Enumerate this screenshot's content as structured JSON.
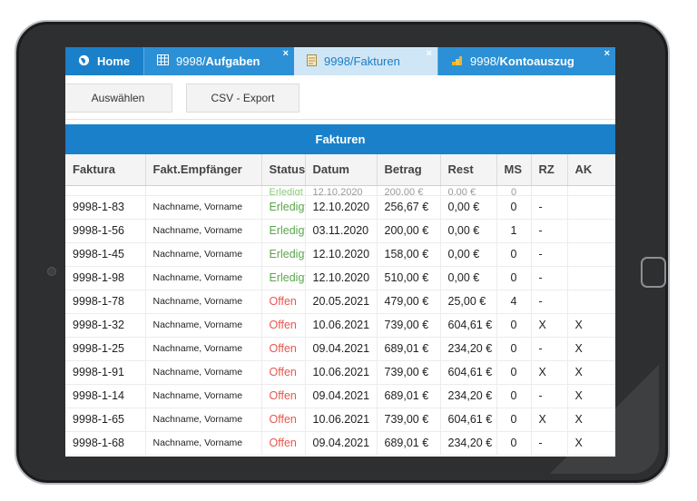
{
  "tabs": [
    {
      "icon": "globe-icon",
      "prefix": "",
      "label": "Home",
      "closable": false
    },
    {
      "icon": "grid-icon",
      "prefix": "9998/",
      "label": "Aufgaben",
      "closable": true
    },
    {
      "icon": "document-icon",
      "prefix": "",
      "label": "9998/Fakturen",
      "closable": true,
      "active": true
    },
    {
      "icon": "coins-icon",
      "prefix": "9998/",
      "label": "Kontoauszug",
      "closable": true
    }
  ],
  "close_glyph": "×",
  "toolbar": {
    "select_label": "Auswählen",
    "csv_label": "CSV - Export"
  },
  "section_title": "Fakturen",
  "columns": [
    "Faktura",
    "Fakt.Empfänger",
    "Status",
    "Datum",
    "Betrag",
    "Rest",
    "MS",
    "RZ",
    "AK"
  ],
  "partial_row": {
    "status": "Erledigt",
    "datum": "12.10.2020",
    "betrag": "200,00 €",
    "rest": "0,00 €",
    "ms": "0"
  },
  "rows": [
    {
      "faktura": "9998-1-83",
      "empf": "Nachname, Vorname",
      "status": "Erledigt",
      "datum": "12.10.2020",
      "betrag": "256,67 €",
      "rest": "0,00 €",
      "ms": "0",
      "rz": "-",
      "ak": ""
    },
    {
      "faktura": "9998-1-56",
      "empf": "Nachname, Vorname",
      "status": "Erledigt",
      "datum": "03.11.2020",
      "betrag": "200,00 €",
      "rest": "0,00 €",
      "ms": "1",
      "rz": "-",
      "ak": ""
    },
    {
      "faktura": "9998-1-45",
      "empf": "Nachname, Vorname",
      "status": "Erledigt",
      "datum": "12.10.2020",
      "betrag": "158,00 €",
      "rest": "0,00 €",
      "ms": "0",
      "rz": "-",
      "ak": ""
    },
    {
      "faktura": "9998-1-98",
      "empf": "Nachname, Vorname",
      "status": "Erledigt",
      "datum": "12.10.2020",
      "betrag": "510,00 €",
      "rest": "0,00 €",
      "ms": "0",
      "rz": "-",
      "ak": ""
    },
    {
      "faktura": "9998-1-78",
      "empf": "Nachname, Vorname",
      "status": "Offen",
      "datum": "20.05.2021",
      "betrag": "479,00 €",
      "rest": "25,00 €",
      "ms": "4",
      "rz": "-",
      "ak": ""
    },
    {
      "faktura": "9998-1-32",
      "empf": "Nachname, Vorname",
      "status": "Offen",
      "datum": "10.06.2021",
      "betrag": "739,00 €",
      "rest": "604,61 €",
      "ms": "0",
      "rz": "X",
      "ak": "X"
    },
    {
      "faktura": "9998-1-25",
      "empf": "Nachname, Vorname",
      "status": "Offen",
      "datum": "09.04.2021",
      "betrag": "689,01 €",
      "rest": "234,20 €",
      "ms": "0",
      "rz": "-",
      "ak": "X"
    },
    {
      "faktura": "9998-1-91",
      "empf": "Nachname, Vorname",
      "status": "Offen",
      "datum": "10.06.2021",
      "betrag": "739,00 €",
      "rest": "604,61 €",
      "ms": "0",
      "rz": "X",
      "ak": "X"
    },
    {
      "faktura": "9998-1-14",
      "empf": "Nachname, Vorname",
      "status": "Offen",
      "datum": "09.04.2021",
      "betrag": "689,01 €",
      "rest": "234,20 €",
      "ms": "0",
      "rz": "-",
      "ak": "X"
    },
    {
      "faktura": "9998-1-65",
      "empf": "Nachname, Vorname",
      "status": "Offen",
      "datum": "10.06.2021",
      "betrag": "739,00 €",
      "rest": "604,61 €",
      "ms": "0",
      "rz": "X",
      "ak": "X"
    },
    {
      "faktura": "9998-1-68",
      "empf": "Nachname, Vorname",
      "status": "Offen",
      "datum": "09.04.2021",
      "betrag": "689,01 €",
      "rest": "234,20 €",
      "ms": "0",
      "rz": "-",
      "ak": "X"
    }
  ],
  "colors": {
    "accent": "#1a80c9",
    "status_ok": "#5aa64a",
    "status_open": "#e8574f"
  }
}
